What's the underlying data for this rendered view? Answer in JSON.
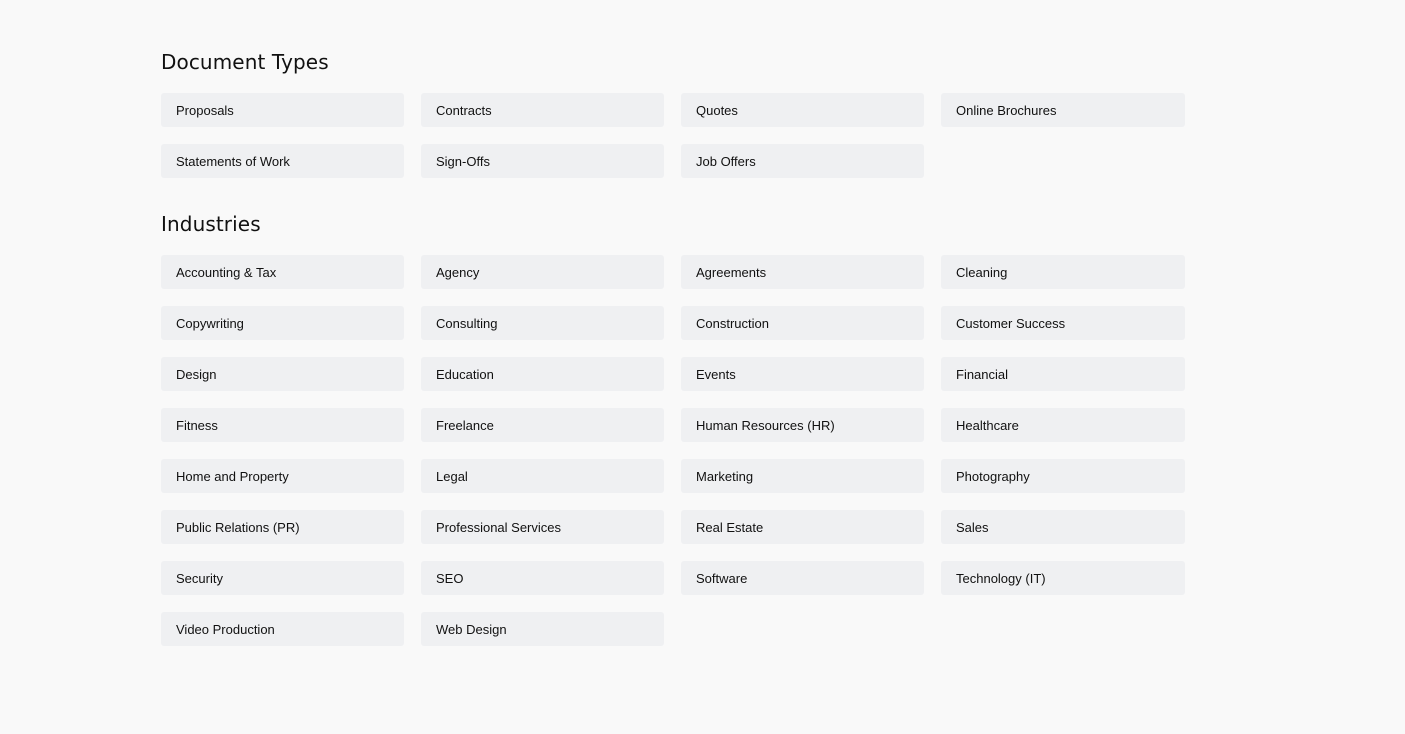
{
  "document_types": {
    "title": "Document Types",
    "items": [
      "Proposals",
      "Contracts",
      "Quotes",
      "Online Brochures",
      "Statements of Work",
      "Sign-Offs",
      "Job Offers"
    ]
  },
  "industries": {
    "title": "Industries",
    "items": [
      "Accounting & Tax",
      "Agency",
      "Agreements",
      "Cleaning",
      "Copywriting",
      "Consulting",
      "Construction",
      "Customer Success",
      "Design",
      "Education",
      "Events",
      "Financial",
      "Fitness",
      "Freelance",
      "Human Resources (HR)",
      "Healthcare",
      "Home and Property",
      "Legal",
      "Marketing",
      "Photography",
      "Public Relations (PR)",
      "Professional Services",
      "Real Estate",
      "Sales",
      "Security",
      "SEO",
      "Software",
      "Technology (IT)",
      "Video Production",
      "Web Design"
    ]
  }
}
